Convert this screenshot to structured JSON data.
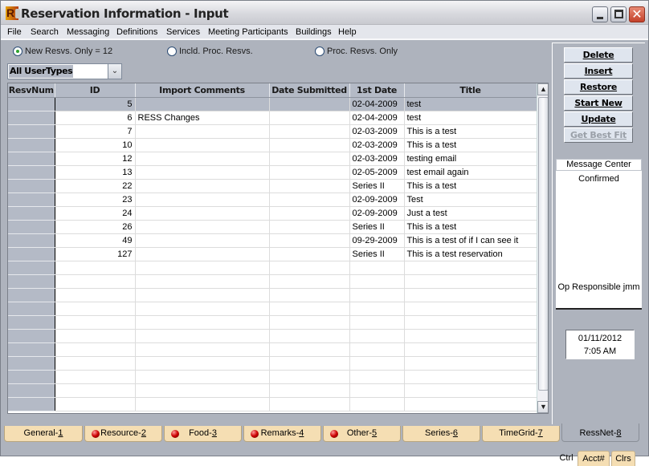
{
  "window": {
    "title": "Reservation Information - Input",
    "app_icon": "ress-logo-icon",
    "controls": [
      "minimize",
      "maximize",
      "close"
    ]
  },
  "menu": [
    "File",
    "Search",
    "Messaging",
    "Definitions",
    "Services",
    "Meeting Participants",
    "Buildings",
    "Help"
  ],
  "filters": {
    "radios": [
      {
        "label": "New Resvs. Only  = 12",
        "selected": true
      },
      {
        "label": "Incld. Proc. Resvs.",
        "selected": false
      },
      {
        "label": "Proc. Resvs. Only",
        "selected": false
      }
    ],
    "usertype_select": "All UserTypes"
  },
  "grid": {
    "columns": [
      "ResvNum",
      "ID",
      "Import Comments",
      "Date Submitted",
      "1st Date",
      "Title"
    ],
    "rows": [
      {
        "resvnum": "",
        "id": "5",
        "comments": "",
        "submitted": "",
        "first_date": "02-04-2009",
        "title": "test",
        "selected": true
      },
      {
        "resvnum": "",
        "id": "6",
        "comments": "RESS Changes",
        "submitted": "",
        "first_date": "02-04-2009",
        "title": "test"
      },
      {
        "resvnum": "",
        "id": "7",
        "comments": "",
        "submitted": "",
        "first_date": "02-03-2009",
        "title": "This is a test"
      },
      {
        "resvnum": "",
        "id": "10",
        "comments": "",
        "submitted": "",
        "first_date": "02-03-2009",
        "title": "This is a test"
      },
      {
        "resvnum": "",
        "id": "12",
        "comments": "",
        "submitted": "",
        "first_date": "02-03-2009",
        "title": "testing email"
      },
      {
        "resvnum": "",
        "id": "13",
        "comments": "",
        "submitted": "",
        "first_date": "02-05-2009",
        "title": "test email again"
      },
      {
        "resvnum": "",
        "id": "22",
        "comments": "",
        "submitted": "",
        "first_date": "Series II",
        "title": "This is a test"
      },
      {
        "resvnum": "",
        "id": "23",
        "comments": "",
        "submitted": "",
        "first_date": "02-09-2009",
        "title": "Test"
      },
      {
        "resvnum": "",
        "id": "24",
        "comments": "",
        "submitted": "",
        "first_date": "02-09-2009",
        "title": "Just a test"
      },
      {
        "resvnum": "",
        "id": "26",
        "comments": "",
        "submitted": "",
        "first_date": "Series II",
        "title": "This is a test"
      },
      {
        "resvnum": "",
        "id": "49",
        "comments": "",
        "submitted": "",
        "first_date": "09-29-2009",
        "title": "This is a test of if I can see it"
      },
      {
        "resvnum": "",
        "id": "127",
        "comments": "",
        "submitted": "",
        "first_date": "Series II",
        "title": "This is a test reservation"
      }
    ],
    "empty_rows": 11
  },
  "actions": [
    {
      "label": "Delete",
      "enabled": true
    },
    {
      "label": "Insert",
      "enabled": true
    },
    {
      "label": "Restore",
      "enabled": true
    },
    {
      "label": "Start New",
      "enabled": true
    },
    {
      "label": "Update",
      "enabled": true
    },
    {
      "label": "Get Best Fit",
      "enabled": false
    }
  ],
  "message_center": {
    "header": "Message Center",
    "status": "Confirmed",
    "operator": "Op Responsible jmm"
  },
  "clock": {
    "date": "01/11/2012",
    "time": "7:05 AM"
  },
  "mini_tabs": [
    "Ctrl",
    "Acct#",
    "Clrs"
  ],
  "bottom_tabs": [
    {
      "label": "General-",
      "key": "1",
      "bulb": false
    },
    {
      "label": "Resource-",
      "key": "2",
      "bulb": true
    },
    {
      "label": "Food-",
      "key": "3",
      "bulb": true
    },
    {
      "label": "Remarks-",
      "key": "4",
      "bulb": true
    },
    {
      "label": "Other-",
      "key": "5",
      "bulb": true
    },
    {
      "label": "Series-",
      "key": "6",
      "bulb": false
    },
    {
      "label": "TimeGrid-",
      "key": "7",
      "bulb": false
    },
    {
      "label": "RessNet-",
      "key": "8",
      "bulb": false,
      "active": true
    }
  ]
}
